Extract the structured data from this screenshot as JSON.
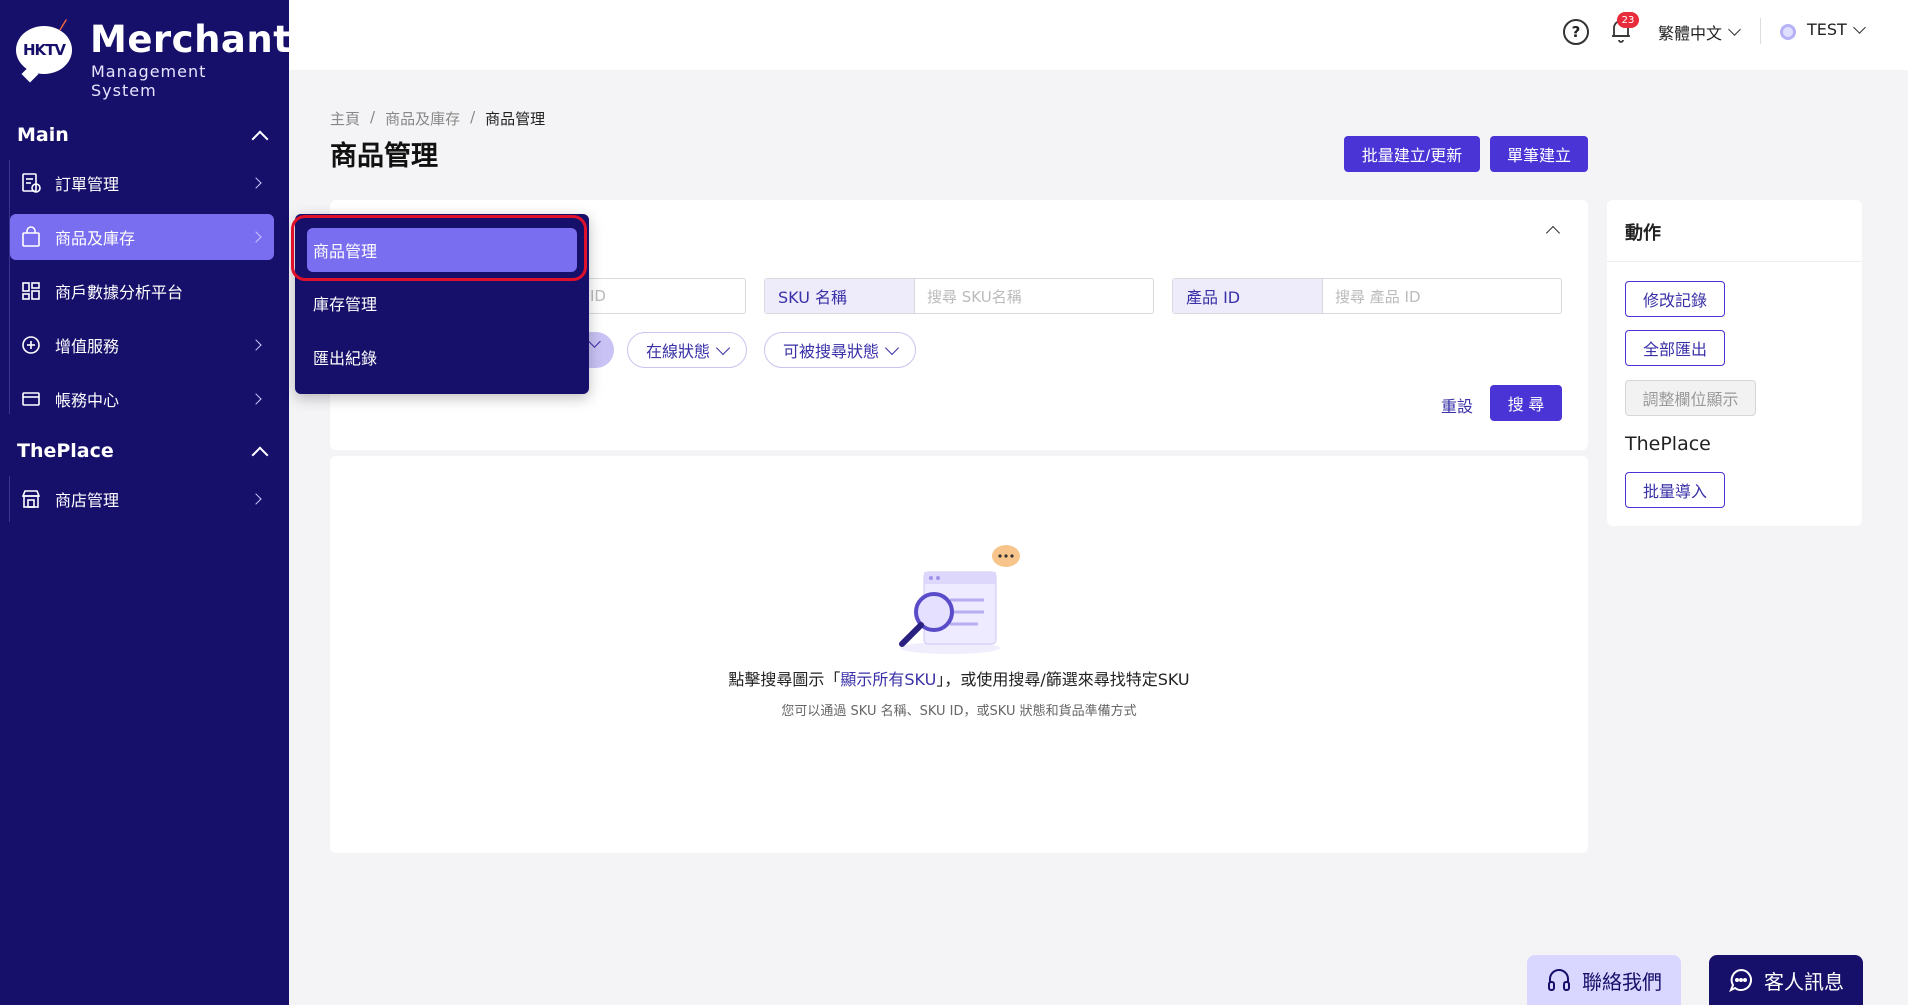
{
  "brand": {
    "logo_text": "HKTV",
    "title": "Merchant",
    "subtitle": "Management System"
  },
  "sidebar": {
    "main_label": "Main",
    "items": [
      {
        "label": "訂單管理"
      },
      {
        "label": "商品及庫存"
      },
      {
        "label": "商戶數據分析平台"
      },
      {
        "label": "增值服務"
      },
      {
        "label": "帳務中心"
      }
    ],
    "theplace_label": "ThePlace",
    "theplace_items": [
      {
        "label": "商店管理"
      }
    ]
  },
  "flyout": {
    "items": [
      {
        "label": "商品管理"
      },
      {
        "label": "庫存管理"
      },
      {
        "label": "匯出紀錄"
      }
    ]
  },
  "topbar": {
    "notifications": "23",
    "language": "繁體中文",
    "user": "TEST"
  },
  "breadcrumb": {
    "home": "主頁",
    "parent": "商品及庫存",
    "current": "商品管理"
  },
  "page": {
    "title": "商品管理",
    "bulk_button": "批量建立/更新",
    "single_button": "單筆建立"
  },
  "filters": {
    "partial_placeholder": "ID",
    "sku_name_label": "SKU 名稱",
    "sku_name_placeholder": "搜尋 SKU名稱",
    "product_id_label": "產品 ID",
    "product_id_placeholder": "搜尋 產品 ID",
    "online_status": "在線狀態",
    "searchable_status": "可被搜尋狀態",
    "reset": "重設",
    "search": "搜 尋"
  },
  "empty": {
    "main_prefix": "點擊搜尋圖示「",
    "main_link": "顯示所有SKU",
    "main_suffix": "」，或使用搜尋/篩選來尋找特定SKU",
    "sub": "您可以通過 SKU 名稱、SKU ID，或SKU 狀態和貨品準備方式"
  },
  "actions": {
    "title": "動作",
    "edit_log": "修改記錄",
    "export_all": "全部匯出",
    "adjust_columns": "調整欄位顯示",
    "theplace": "ThePlace",
    "bulk_import": "批量導入"
  },
  "floating": {
    "contact": "聯絡我們",
    "messages": "客人訊息"
  },
  "colors": {
    "sidebar": "#17106b",
    "accent": "#4a34d6",
    "active": "#7a6ef0",
    "highlight": "#e0102a"
  }
}
